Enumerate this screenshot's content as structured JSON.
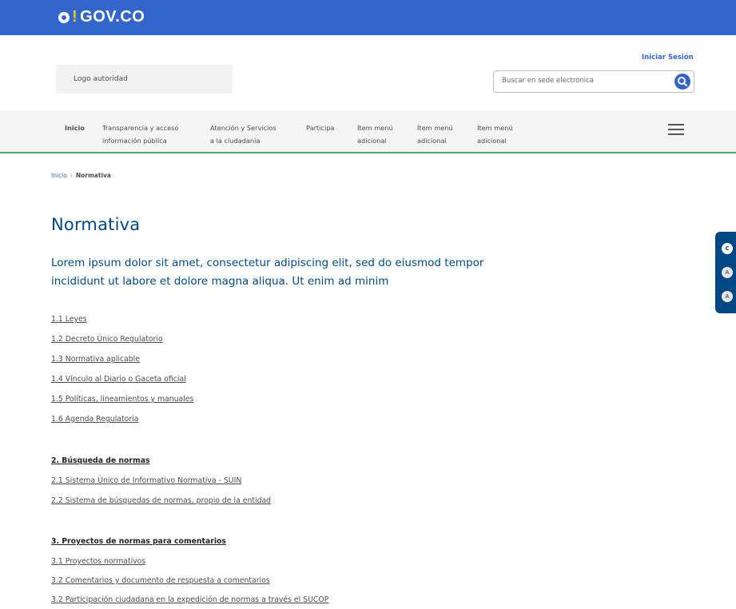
{
  "topbar": {
    "logo_text": "GOV.CO"
  },
  "header": {
    "logo_authority": "Logo autoridad",
    "login_label": "Iniciar Sesión",
    "search_placeholder": "Buscar en sede electrónica"
  },
  "nav": {
    "items": [
      {
        "line1": "Inicio",
        "line2": ""
      },
      {
        "line1": "Transparencia y acceso",
        "line2": "información pública"
      },
      {
        "line1": "Atención y Servicios",
        "line2": "a la ciudadanía"
      },
      {
        "line1": "Participa",
        "line2": ""
      },
      {
        "line1": "Ítem menú",
        "line2": "adicional"
      },
      {
        "line1": "Ítem menú",
        "line2": "adicional"
      },
      {
        "line1": "Ítem menú",
        "line2": "adicional"
      }
    ]
  },
  "breadcrumb": {
    "home": "Inicio",
    "separator": "›",
    "current": "Normativa"
  },
  "page": {
    "title": "Normativa",
    "intro": "Lorem ipsum dolor sit amet, consectetur adipiscing elit, sed do eiusmod tempor incididunt ut labore et dolore magna aliqua. Ut enim ad minim"
  },
  "sections": {
    "s1_links": [
      "1.1 Leyes",
      "1.2 Decreto Único Regulatorio",
      "1.3 Normativa aplicable",
      "1.4 Vínculo al Diario o Gaceta oficial",
      "1.5 Políticas, lineamientos y manuales",
      "1.6 Agenda Regulatoria"
    ],
    "s2_title": "2. Búsqueda de normas",
    "s2_links": [
      "2.1 Sistema Único de Informativo Normativa - SUIN",
      "2.2 Sistema de búsquedas de normas, propio de la entidad"
    ],
    "s3_title": "3. Proyectos de normas para comentarios",
    "s3_links": [
      "3.1 Proyectos normativos",
      "3.2 Comentarios y documento de respuesta a comentarios",
      "3.2 Participación ciudadana en la expedición de normas a través el SUCOP"
    ]
  },
  "a11y": {
    "contrast": "C",
    "decrease_font": "A",
    "increase_font": "A"
  }
}
